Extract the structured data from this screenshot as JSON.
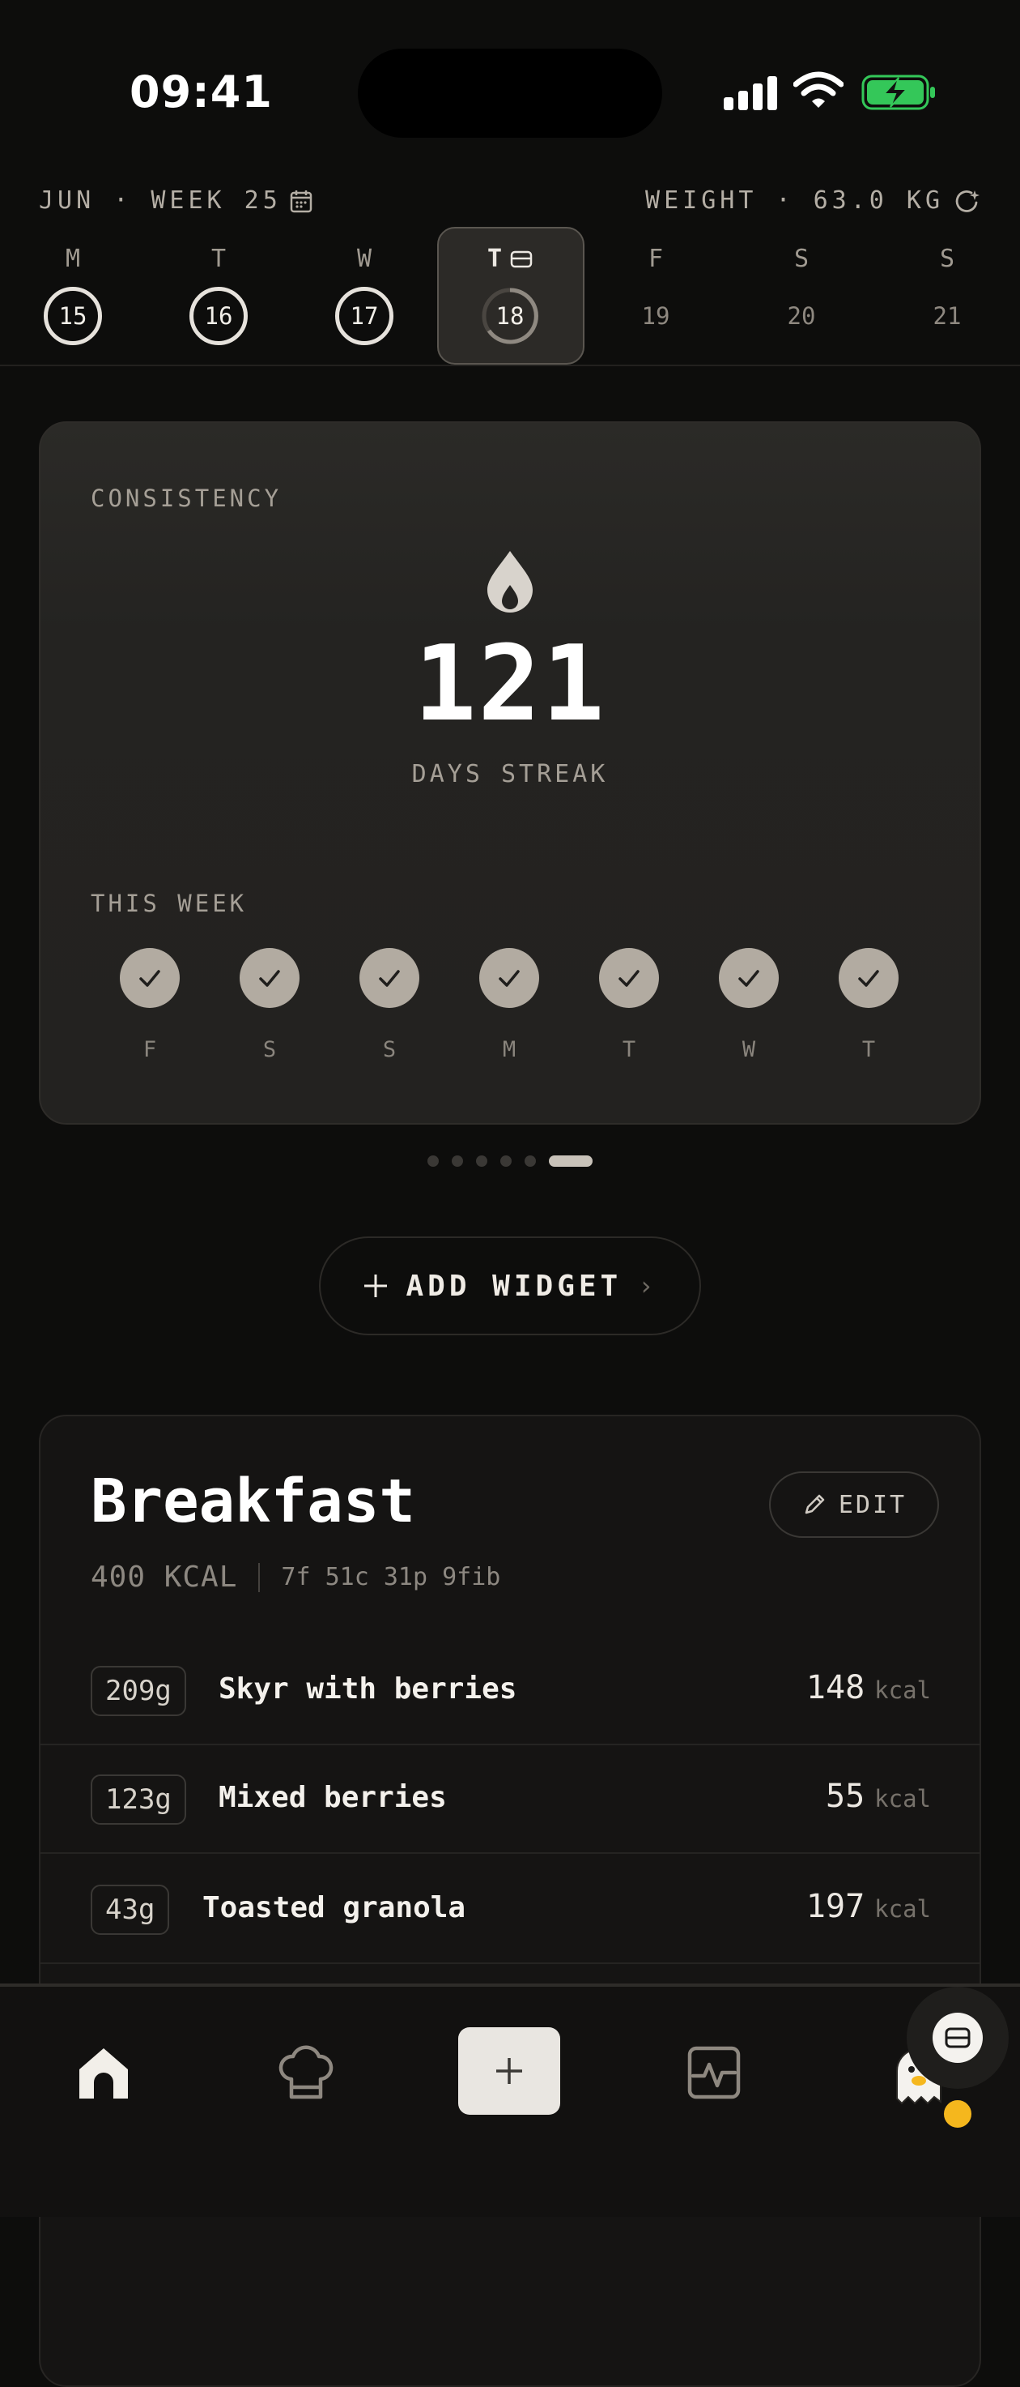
{
  "status_bar": {
    "time": "09:41"
  },
  "week_header": {
    "label": "JUN · WEEK 25",
    "weight": "WEIGHT · 63.0 KG",
    "days": [
      {
        "letter": "M",
        "date": "15",
        "state": "complete"
      },
      {
        "letter": "T",
        "date": "16",
        "state": "complete"
      },
      {
        "letter": "W",
        "date": "17",
        "state": "complete"
      },
      {
        "letter": "T",
        "date": "18",
        "state": "today"
      },
      {
        "letter": "F",
        "date": "19",
        "state": "future"
      },
      {
        "letter": "S",
        "date": "20",
        "state": "future"
      },
      {
        "letter": "S",
        "date": "21",
        "state": "future"
      }
    ]
  },
  "consistency": {
    "title": "CONSISTENCY",
    "streak_value": "121",
    "streak_label": "DAYS STREAK",
    "week_title": "THIS WEEK",
    "week_days": [
      "F",
      "S",
      "S",
      "M",
      "T",
      "W",
      "T"
    ]
  },
  "pager": {
    "count": 6,
    "active": 6
  },
  "add_widget": {
    "label": "ADD WIDGET"
  },
  "breakfast": {
    "title": "Breakfast",
    "edit_label": "EDIT",
    "kcal": "400 KCAL",
    "macros": "7f 51c 31p 9fib",
    "items": [
      {
        "qty": "209g",
        "name": "Skyr with berries",
        "kcal": "148",
        "unit": "kcal"
      },
      {
        "qty": "123g",
        "name": "Mixed berries",
        "kcal": "55",
        "unit": "kcal"
      },
      {
        "qty": "43g",
        "name": "Toasted granola",
        "kcal": "197",
        "unit": "kcal"
      }
    ]
  },
  "nav": {
    "items": [
      "home-icon",
      "chef-hat-icon",
      "plus-icon",
      "activity-icon",
      "ghost-avatar"
    ]
  },
  "colors": {
    "accent_check": "#b2aba1",
    "battery_green": "#34c759",
    "badge": "#f5b71d"
  }
}
